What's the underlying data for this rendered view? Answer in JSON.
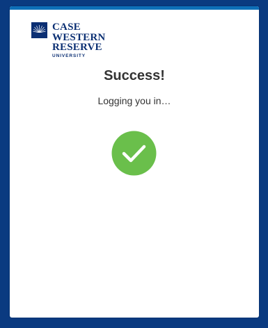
{
  "logo": {
    "line1": "CASE",
    "line2": "WESTERN",
    "line3": "RESERVE",
    "line4": "UNIVERSITY",
    "color": "#0b2f73"
  },
  "status": {
    "title": "Success!",
    "message": "Logging you in…",
    "icon": "check-circle-icon",
    "icon_color": "#6abf4b"
  },
  "colors": {
    "background": "#0a3a80",
    "card_accent": "#0e6fb8"
  }
}
